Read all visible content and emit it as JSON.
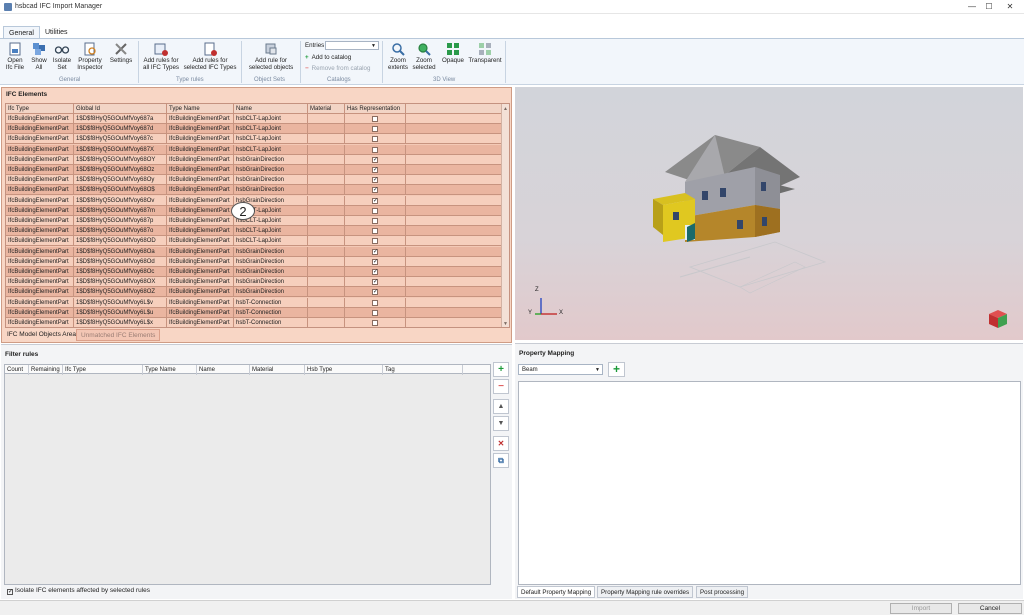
{
  "window": {
    "title": "hsbcad IFC Import Manager",
    "min_glyph": "—",
    "max_glyph": "☐",
    "close_glyph": "✕"
  },
  "tabs": [
    "General",
    "Utilities"
  ],
  "ribbon": {
    "buttons": {
      "open": "Open Ifc File",
      "show_all": "Show All",
      "isolate_set": "Isolate Set",
      "property_inspector": "Property Inspector",
      "settings": "Settings",
      "add_rules_all": "Add rules for all IFC Types",
      "add_rules_selected": "Add rules for selected IFC Types",
      "add_rule_selected_objects": "Add rule for selected objects",
      "zoom_extents": "Zoom extents",
      "zoom_selected": "Zoom selected",
      "opaque": "Opaque",
      "transparent": "Transparent"
    },
    "groups": {
      "general": "General",
      "type_rules": "Type rules",
      "object_sets": "Object Sets",
      "catalogs": "Catalogs",
      "view3d": "3D View"
    },
    "catalogs": {
      "entries_label": "Entries",
      "entries_value": "",
      "add": "Add to catalog",
      "remove": "Remove from catalog"
    }
  },
  "ifc_elements": {
    "title": "IFC Elements",
    "columns": [
      "Ifc Type",
      "Global Id",
      "Type Name",
      "Name",
      "Material",
      "Has Representation"
    ],
    "rows": [
      {
        "ifc_type": "IfcBuildingElementPart",
        "global_id": "1$D$f8HyQ5GOuMfVoy687a",
        "type_name": "IfcBuildingElementPart",
        "name": "hsbCLT-LapJoint",
        "material": "",
        "has_rep": false
      },
      {
        "ifc_type": "IfcBuildingElementPart",
        "global_id": "1$D$f8HyQ5GOuMfVoy687d",
        "type_name": "IfcBuildingElementPart",
        "name": "hsbCLT-LapJoint",
        "material": "",
        "has_rep": false
      },
      {
        "ifc_type": "IfcBuildingElementPart",
        "global_id": "1$D$f8HyQ5GOuMfVoy687c",
        "type_name": "IfcBuildingElementPart",
        "name": "hsbCLT-LapJoint",
        "material": "",
        "has_rep": false
      },
      {
        "ifc_type": "IfcBuildingElementPart",
        "global_id": "1$D$f8HyQ5GOuMfVoy687X",
        "type_name": "IfcBuildingElementPart",
        "name": "hsbCLT-LapJoint",
        "material": "",
        "has_rep": false
      },
      {
        "ifc_type": "IfcBuildingElementPart",
        "global_id": "1$D$f8HyQ5GOuMfVoy68OY",
        "type_name": "IfcBuildingElementPart",
        "name": "hsbGrainDirection",
        "material": "",
        "has_rep": true
      },
      {
        "ifc_type": "IfcBuildingElementPart",
        "global_id": "1$D$f8HyQ5GOuMfVoy68Oz",
        "type_name": "IfcBuildingElementPart",
        "name": "hsbGrainDirection",
        "material": "",
        "has_rep": true
      },
      {
        "ifc_type": "IfcBuildingElementPart",
        "global_id": "1$D$f8HyQ5GOuMfVoy68Oy",
        "type_name": "IfcBuildingElementPart",
        "name": "hsbGrainDirection",
        "material": "",
        "has_rep": true
      },
      {
        "ifc_type": "IfcBuildingElementPart",
        "global_id": "1$D$f8HyQ5GOuMfVoy68O$",
        "type_name": "IfcBuildingElementPart",
        "name": "hsbGrainDirection",
        "material": "",
        "has_rep": true
      },
      {
        "ifc_type": "IfcBuildingElementPart",
        "global_id": "1$D$f8HyQ5GOuMfVoy68Ov",
        "type_name": "IfcBuildingElementPart",
        "name": "hsbGrainDirection",
        "material": "",
        "has_rep": true
      },
      {
        "ifc_type": "IfcBuildingElementPart",
        "global_id": "1$D$f8HyQ5GOuMfVoy687m",
        "type_name": "IfcBuildingElementPart",
        "name": "hsbCLT-LapJoint",
        "material": "",
        "has_rep": false
      },
      {
        "ifc_type": "IfcBuildingElementPart",
        "global_id": "1$D$f8HyQ5GOuMfVoy687p",
        "type_name": "IfcBuildingElementPart",
        "name": "hsbCLT-LapJoint",
        "material": "",
        "has_rep": false
      },
      {
        "ifc_type": "IfcBuildingElementPart",
        "global_id": "1$D$f8HyQ5GOuMfVoy687o",
        "type_name": "IfcBuildingElementPart",
        "name": "hsbCLT-LapJoint",
        "material": "",
        "has_rep": false
      },
      {
        "ifc_type": "IfcBuildingElementPart",
        "global_id": "1$D$f8HyQ5GOuMfVoy68OD",
        "type_name": "IfcBuildingElementPart",
        "name": "hsbCLT-LapJoint",
        "material": "",
        "has_rep": false
      },
      {
        "ifc_type": "IfcBuildingElementPart",
        "global_id": "1$D$f8HyQ5GOuMfVoy68Oa",
        "type_name": "IfcBuildingElementPart",
        "name": "hsbGrainDirection",
        "material": "",
        "has_rep": true
      },
      {
        "ifc_type": "IfcBuildingElementPart",
        "global_id": "1$D$f8HyQ5GOuMfVoy68Od",
        "type_name": "IfcBuildingElementPart",
        "name": "hsbGrainDirection",
        "material": "",
        "has_rep": true
      },
      {
        "ifc_type": "IfcBuildingElementPart",
        "global_id": "1$D$f8HyQ5GOuMfVoy68Oc",
        "type_name": "IfcBuildingElementPart",
        "name": "hsbGrainDirection",
        "material": "",
        "has_rep": true
      },
      {
        "ifc_type": "IfcBuildingElementPart",
        "global_id": "1$D$f8HyQ5GOuMfVoy68OX",
        "type_name": "IfcBuildingElementPart",
        "name": "hsbGrainDirection",
        "material": "",
        "has_rep": true
      },
      {
        "ifc_type": "IfcBuildingElementPart",
        "global_id": "1$D$f8HyQ5GOuMfVoy68OZ",
        "type_name": "IfcBuildingElementPart",
        "name": "hsbGrainDirection",
        "material": "",
        "has_rep": true
      },
      {
        "ifc_type": "IfcBuildingElementPart",
        "global_id": "1$D$f8HyQ5GOuMfVoy6L$v",
        "type_name": "IfcBuildingElementPart",
        "name": "hsbT-Connection",
        "material": "",
        "has_rep": false
      },
      {
        "ifc_type": "IfcBuildingElementPart",
        "global_id": "1$D$f8HyQ5GOuMfVoy6L$u",
        "type_name": "IfcBuildingElementPart",
        "name": "hsbT-Connection",
        "material": "",
        "has_rep": false
      },
      {
        "ifc_type": "IfcBuildingElementPart",
        "global_id": "1$D$f8HyQ5GOuMfVoy6L$x",
        "type_name": "IfcBuildingElementPart",
        "name": "hsbT-Connection",
        "material": "",
        "has_rep": false
      }
    ],
    "callout_number": "2",
    "bottom_tabs": [
      "IFC Model Objects Area",
      "Unmatched IFC Elements"
    ]
  },
  "viewport": {
    "axis_z": "Z",
    "axis_y": "Y",
    "axis_x": "X"
  },
  "filter_rules": {
    "title": "Filter rules",
    "columns": [
      "Count",
      "Remaining",
      "Ifc Type",
      "Type Name",
      "Name",
      "Material",
      "Hsb Type",
      "Tag"
    ],
    "side_buttons": [
      "+",
      "−",
      "▲",
      "▼",
      "✕",
      "⧉"
    ],
    "isolate_label": "Isolate IFC elements affected by selected rules",
    "isolate_checked": true
  },
  "property_mapping": {
    "title": "Property Mapping",
    "selected": "Beam",
    "add_label": "+",
    "tabs": [
      "Default Property Mapping",
      "Property Mapping rule overrides",
      "Post processing"
    ]
  },
  "footer": {
    "import": "Import",
    "cancel": "Cancel"
  },
  "colors": {
    "ifc_panel": "#f8d6c5",
    "row_alt": "#eab5a0",
    "accent_green": "#1b9a38",
    "remove_red": "#e06060"
  }
}
